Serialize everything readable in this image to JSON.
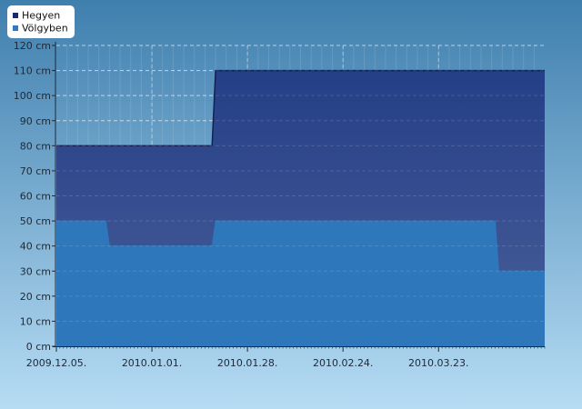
{
  "chart_data": {
    "type": "area",
    "y_unit": "cm",
    "ylim": [
      0,
      120
    ],
    "y_ticks": [
      0,
      10,
      20,
      30,
      40,
      50,
      60,
      70,
      80,
      90,
      100,
      110,
      120
    ],
    "y_tick_labels": [
      "0 cm",
      "10 cm",
      "20 cm",
      "30 cm",
      "40 cm",
      "50 cm",
      "60 cm",
      "70 cm",
      "80 cm",
      "90 cm",
      "100 cm",
      "110 cm",
      "120 cm"
    ],
    "xlim": [
      "2009-12-05",
      "2010-04-22"
    ],
    "x_ticks": [
      "2009-12-05",
      "2010-01-01",
      "2010-01-28",
      "2010-02-24",
      "2010-03-23"
    ],
    "x_tick_labels": [
      "2009.12.05.",
      "2010.01.01.",
      "2010.01.28.",
      "2010.02.24.",
      "2010.03.23."
    ],
    "grid": true,
    "legend_position": "top-left",
    "series": [
      {
        "name": "Hegyen",
        "color": "#1a2a6c",
        "points": [
          [
            "2009-12-05",
            80
          ],
          [
            "2010-01-18",
            80
          ],
          [
            "2010-01-19",
            110
          ],
          [
            "2010-04-22",
            110
          ]
        ]
      },
      {
        "name": "Völgyben",
        "color": "#2e7bbd",
        "points": [
          [
            "2009-12-05",
            50
          ],
          [
            "2009-12-19",
            50
          ],
          [
            "2009-12-20",
            40
          ],
          [
            "2010-01-18",
            40
          ],
          [
            "2010-01-19",
            50
          ],
          [
            "2010-04-08",
            50
          ],
          [
            "2010-04-09",
            30
          ],
          [
            "2010-04-22",
            30
          ]
        ]
      }
    ]
  },
  "colors": {
    "background_top": "#3f7fae",
    "background_bottom": "#b6dcf4",
    "hegyen_fill_top": "#243f86",
    "hegyen_fill_bottom": "#4a5f9a",
    "hegyen_line": "#141f55",
    "volgyben_fill": "#2e77bb",
    "grid": "#ffffff",
    "axis": "#1c2a3a"
  }
}
